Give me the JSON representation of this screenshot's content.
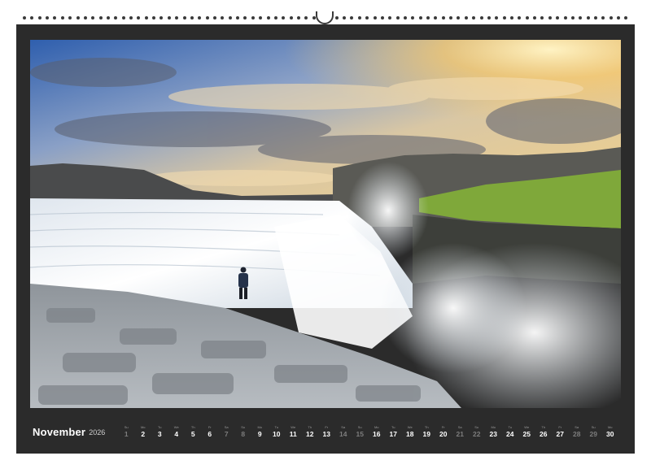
{
  "calendar": {
    "month": "November",
    "year": "2026",
    "days": [
      {
        "n": "1",
        "w": "Su",
        "weekend": true
      },
      {
        "n": "2",
        "w": "Mo",
        "weekend": false
      },
      {
        "n": "3",
        "w": "Tu",
        "weekend": false
      },
      {
        "n": "4",
        "w": "We",
        "weekend": false
      },
      {
        "n": "5",
        "w": "Th",
        "weekend": false
      },
      {
        "n": "6",
        "w": "Fr",
        "weekend": false
      },
      {
        "n": "7",
        "w": "Sa",
        "weekend": true
      },
      {
        "n": "8",
        "w": "Su",
        "weekend": true
      },
      {
        "n": "9",
        "w": "Mo",
        "weekend": false
      },
      {
        "n": "10",
        "w": "Tu",
        "weekend": false
      },
      {
        "n": "11",
        "w": "We",
        "weekend": false
      },
      {
        "n": "12",
        "w": "Th",
        "weekend": false
      },
      {
        "n": "13",
        "w": "Fr",
        "weekend": false
      },
      {
        "n": "14",
        "w": "Sa",
        "weekend": true
      },
      {
        "n": "15",
        "w": "Su",
        "weekend": true
      },
      {
        "n": "16",
        "w": "Mo",
        "weekend": false
      },
      {
        "n": "17",
        "w": "Tu",
        "weekend": false
      },
      {
        "n": "18",
        "w": "We",
        "weekend": false
      },
      {
        "n": "19",
        "w": "Th",
        "weekend": false
      },
      {
        "n": "20",
        "w": "Fr",
        "weekend": false
      },
      {
        "n": "21",
        "w": "Sa",
        "weekend": true
      },
      {
        "n": "22",
        "w": "Su",
        "weekend": true
      },
      {
        "n": "23",
        "w": "Mo",
        "weekend": false
      },
      {
        "n": "24",
        "w": "Tu",
        "weekend": false
      },
      {
        "n": "25",
        "w": "We",
        "weekend": false
      },
      {
        "n": "26",
        "w": "Th",
        "weekend": false
      },
      {
        "n": "27",
        "w": "Fr",
        "weekend": false
      },
      {
        "n": "28",
        "w": "Sa",
        "weekend": true
      },
      {
        "n": "29",
        "w": "Su",
        "weekend": true
      },
      {
        "n": "30",
        "w": "Mo",
        "weekend": false
      }
    ]
  },
  "colors": {
    "frame": "#2b2b2b",
    "sky_blue": "#3f74c4",
    "sunset": "#f2c46a",
    "grass": "#7fa83a",
    "water": "#eef2f6",
    "rock": "#9ea3a8"
  }
}
